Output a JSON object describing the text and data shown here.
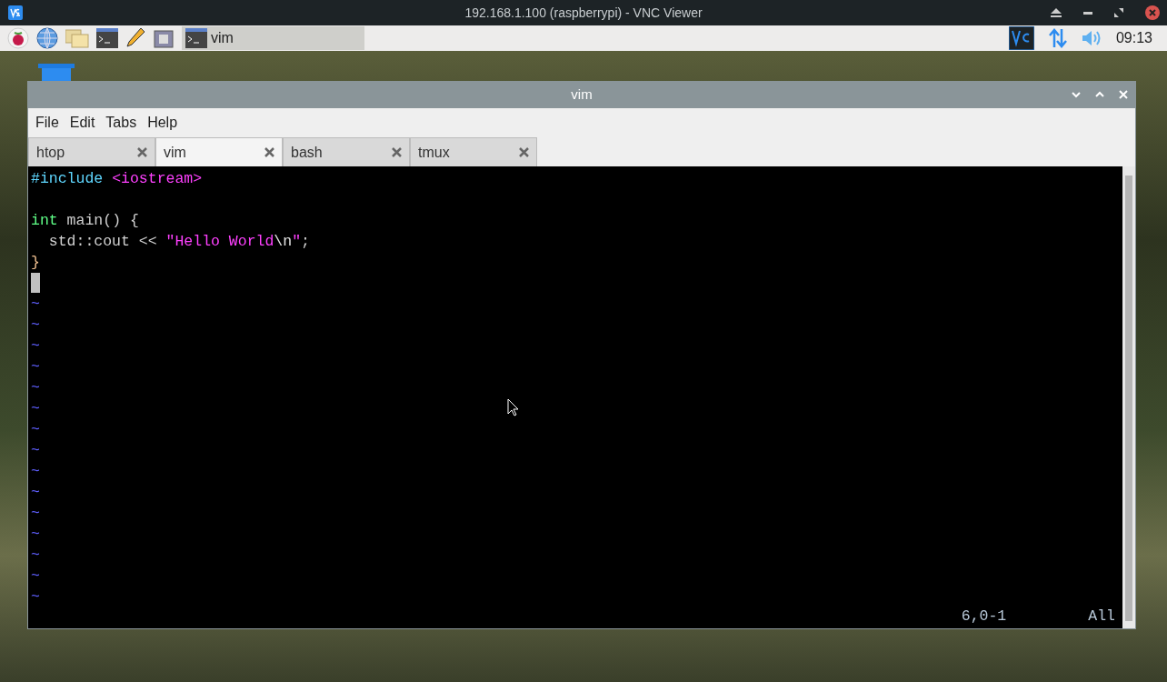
{
  "vnc_window": {
    "title": "192.168.1.100 (raspberrypi) - VNC Viewer"
  },
  "taskbar": {
    "tasks": [
      {
        "label": "vim",
        "selected": true
      }
    ],
    "clock": "09:13"
  },
  "terminal": {
    "title": "vim",
    "menu": [
      "File",
      "Edit",
      "Tabs",
      "Help"
    ],
    "tabs": [
      {
        "label": "htop",
        "selected": false
      },
      {
        "label": "vim",
        "selected": true
      },
      {
        "label": "bash",
        "selected": false
      },
      {
        "label": "tmux",
        "selected": false
      }
    ],
    "buffer_lines": [
      {
        "cursor": false,
        "tokens": [
          {
            "kind": "preproc",
            "text": "#include"
          },
          {
            "kind": "string",
            "text": "<iostream>",
            "space_before": true
          }
        ]
      },
      {
        "cursor": false
      },
      {
        "cursor": false,
        "tokens": [
          {
            "kind": "type",
            "text": "int"
          },
          {
            "kind": "normal",
            "text": " main() {"
          }
        ]
      },
      {
        "cursor": false,
        "tokens": [
          {
            "kind": "normal",
            "text": "  std::cout << "
          },
          {
            "kind": "string",
            "text": "\"Hello World"
          },
          {
            "kind": "special",
            "text": "\\n"
          },
          {
            "kind": "string",
            "text": "\""
          },
          {
            "kind": "normal",
            "text": ";"
          }
        ]
      },
      {
        "cursor": false,
        "tokens": [
          {
            "kind": "brace",
            "text": "}"
          }
        ]
      },
      {
        "cursor": true
      }
    ],
    "empty_line_markers": [
      "~",
      "~",
      "~",
      "~",
      "~",
      "~",
      "~",
      "~",
      "~",
      "~",
      "~",
      "~",
      "~",
      "~",
      "~"
    ],
    "status": {
      "position": "6,0-1",
      "scroll": "All"
    }
  }
}
